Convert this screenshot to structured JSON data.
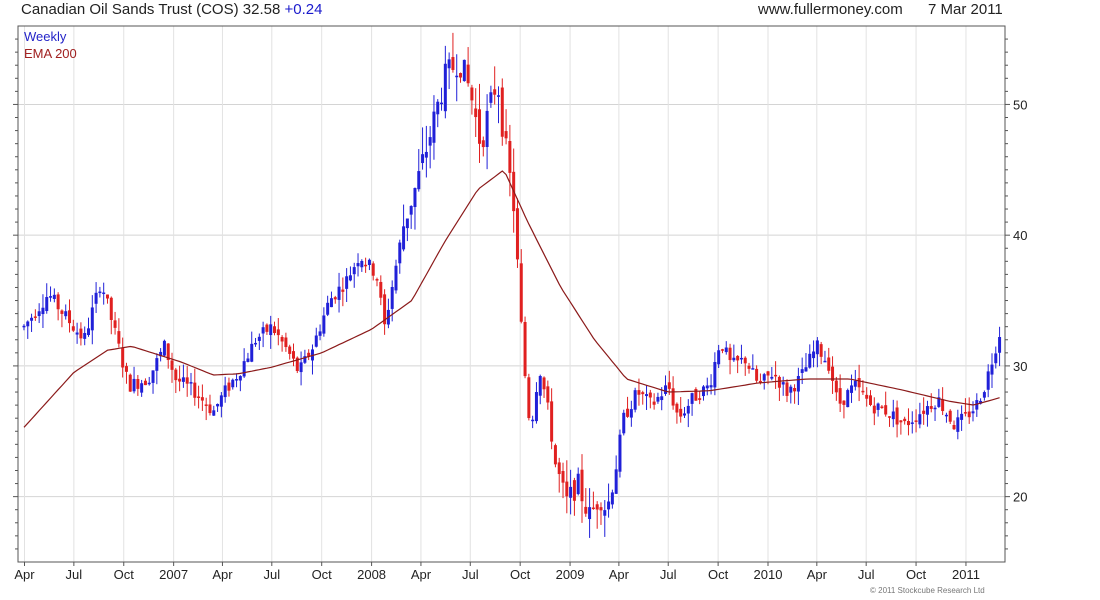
{
  "header": {
    "title": "Canadian Oil Sands Trust (COS)",
    "price": "32.58",
    "change": "+0.24",
    "website": "www.fullermoney.com",
    "date": "7 Mar 2011"
  },
  "legend": {
    "series1": "Weekly",
    "series2": "EMA 200"
  },
  "copyright": "© 2011 Stockcube Research Ltd",
  "colors": {
    "up": "#2020d8",
    "down": "#e02020",
    "ema": "#8b1a1a",
    "grid": "#d4d4d4"
  },
  "chart_data": {
    "type": "candlestick",
    "frequency": "Weekly",
    "ylim": [
      15,
      56
    ],
    "y_ticks": [
      20,
      30,
      40,
      50
    ],
    "x_ticks": [
      "Apr",
      "Jul",
      "Oct",
      "2007",
      "Apr",
      "Jul",
      "Oct",
      "2008",
      "Apr",
      "Jul",
      "Oct",
      "2009",
      "Apr",
      "Jul",
      "Oct",
      "2010",
      "Apr",
      "Jul",
      "Oct",
      "2011"
    ],
    "grid": true,
    "legend_position": "top-left",
    "price_anchors": [
      [
        "2006-03-31",
        33.0
      ],
      [
        "2006-05-15",
        35.5
      ],
      [
        "2006-06-30",
        33.0
      ],
      [
        "2006-07-20",
        32.0
      ],
      [
        "2006-08-20",
        36.5
      ],
      [
        "2006-09-15",
        32.5
      ],
      [
        "2006-10-10",
        28.5
      ],
      [
        "2006-11-15",
        29.0
      ],
      [
        "2006-12-15",
        31.5
      ],
      [
        "2007-01-05",
        29.0
      ],
      [
        "2007-02-10",
        28.0
      ],
      [
        "2007-03-15",
        26.5
      ],
      [
        "2007-04-05",
        28.0
      ],
      [
        "2007-05-01",
        29.5
      ],
      [
        "2007-06-01",
        32.0
      ],
      [
        "2007-07-01",
        33.0
      ],
      [
        "2007-08-01",
        31.0
      ],
      [
        "2007-08-20",
        29.5
      ],
      [
        "2007-09-15",
        31.5
      ],
      [
        "2007-10-15",
        35.0
      ],
      [
        "2007-11-15",
        36.5
      ],
      [
        "2007-12-10",
        38.5
      ],
      [
        "2008-01-10",
        37.0
      ],
      [
        "2008-01-25",
        33.0
      ],
      [
        "2008-03-01",
        41.0
      ],
      [
        "2008-03-25",
        44.0
      ],
      [
        "2008-04-20",
        48.0
      ],
      [
        "2008-05-15",
        52.0
      ],
      [
        "2008-06-10",
        53.5
      ],
      [
        "2008-07-01",
        51.0
      ],
      [
        "2008-07-20",
        47.0
      ],
      [
        "2008-08-20",
        52.0
      ],
      [
        "2008-09-01",
        47.5
      ],
      [
        "2008-09-20",
        42.0
      ],
      [
        "2008-10-06",
        31.0
      ],
      [
        "2008-10-20",
        25.0
      ],
      [
        "2008-11-05",
        30.0
      ],
      [
        "2008-11-20",
        27.0
      ],
      [
        "2008-12-05",
        22.5
      ],
      [
        "2008-12-25",
        19.5
      ],
      [
        "2009-01-15",
        21.0
      ],
      [
        "2009-02-05",
        18.5
      ],
      [
        "2009-02-25",
        20.0
      ],
      [
        "2009-03-10",
        19.0
      ],
      [
        "2009-03-25",
        22.0
      ],
      [
        "2009-04-10",
        26.0
      ],
      [
        "2009-05-05",
        28.0
      ],
      [
        "2009-06-01",
        27.0
      ],
      [
        "2009-07-01",
        28.5
      ],
      [
        "2009-07-20",
        26.0
      ],
      [
        "2009-08-15",
        27.5
      ],
      [
        "2009-09-15",
        28.5
      ],
      [
        "2009-10-05",
        32.0
      ],
      [
        "2009-10-25",
        30.0
      ],
      [
        "2009-11-20",
        30.5
      ],
      [
        "2009-12-15",
        28.5
      ],
      [
        "2010-01-10",
        29.5
      ],
      [
        "2010-02-05",
        28.0
      ],
      [
        "2010-03-01",
        29.0
      ],
      [
        "2010-04-01",
        31.5
      ],
      [
        "2010-04-25",
        30.0
      ],
      [
        "2010-05-10",
        27.0
      ],
      [
        "2010-06-10",
        28.5
      ],
      [
        "2010-07-10",
        27.0
      ],
      [
        "2010-08-10",
        26.5
      ],
      [
        "2010-09-10",
        25.5
      ],
      [
        "2010-10-10",
        26.5
      ],
      [
        "2010-11-10",
        27.5
      ],
      [
        "2010-12-10",
        25.5
      ],
      [
        "2010-12-30",
        26.0
      ],
      [
        "2011-01-20",
        27.0
      ],
      [
        "2011-02-05",
        28.5
      ],
      [
        "2011-02-25",
        31.5
      ],
      [
        "2011-03-07",
        33.0
      ]
    ],
    "ema_anchors": [
      [
        "2006-03-31",
        25.3
      ],
      [
        "2006-07-01",
        29.5
      ],
      [
        "2006-09-01",
        31.2
      ],
      [
        "2006-10-15",
        31.5
      ],
      [
        "2007-01-15",
        30.3
      ],
      [
        "2007-03-15",
        29.3
      ],
      [
        "2007-05-01",
        29.4
      ],
      [
        "2007-07-01",
        29.9
      ],
      [
        "2007-10-01",
        31.0
      ],
      [
        "2008-01-01",
        32.8
      ],
      [
        "2008-03-15",
        35.0
      ],
      [
        "2008-05-15",
        39.5
      ],
      [
        "2008-07-15",
        43.5
      ],
      [
        "2008-09-01",
        45.0
      ],
      [
        "2008-10-15",
        41.0
      ],
      [
        "2008-12-15",
        36.0
      ],
      [
        "2009-02-15",
        32.0
      ],
      [
        "2009-04-15",
        29.0
      ],
      [
        "2009-07-01",
        28.0
      ],
      [
        "2009-09-15",
        28.1
      ],
      [
        "2009-12-15",
        28.7
      ],
      [
        "2010-03-15",
        29.0
      ],
      [
        "2010-06-01",
        29.0
      ],
      [
        "2010-09-01",
        28.2
      ],
      [
        "2010-12-01",
        27.3
      ],
      [
        "2011-01-15",
        27.0
      ],
      [
        "2011-03-07",
        27.6
      ]
    ]
  }
}
